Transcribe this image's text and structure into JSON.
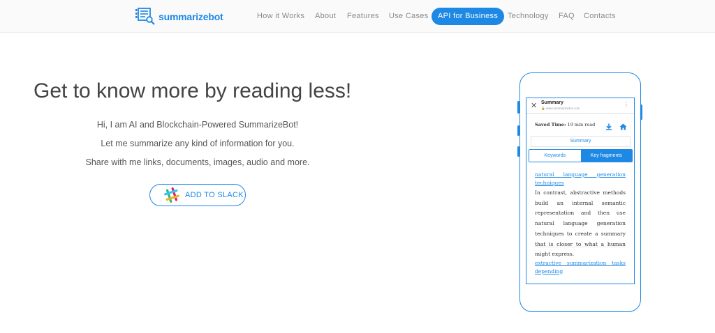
{
  "header": {
    "logo_text": "summarizebot",
    "logo_icon": "document-magnifier-icon",
    "nav": [
      {
        "label": "How it Works",
        "active": false
      },
      {
        "label": "About",
        "active": false
      },
      {
        "label": "Features",
        "active": false
      },
      {
        "label": "Use Cases",
        "active": false
      },
      {
        "label": "API for Business",
        "active": true
      },
      {
        "label": "Technology",
        "active": false
      },
      {
        "label": "FAQ",
        "active": false
      },
      {
        "label": "Contacts",
        "active": false
      }
    ]
  },
  "hero": {
    "headline": "Get to know more by reading less!",
    "lines": [
      "Hi, I am AI and Blockchain-Powered SummarizeBot!",
      "Let me summarize any kind of information for you.",
      "Share with me links, documents, images, audio and more."
    ],
    "slack_button": {
      "label": "ADD TO SLACK",
      "icon": "slack-icon"
    }
  },
  "phone": {
    "app_title": "Summary",
    "app_url": "🔒 www.summarizebot.com",
    "close_icon": "✕",
    "menu_icon": "⋮",
    "saved_time_label": "Saved Time:",
    "saved_time_value": "19 min read",
    "summary_tab": "Summary",
    "tabs": [
      {
        "label": "Keywords",
        "active": false
      },
      {
        "label": "Key fragments",
        "active": true
      }
    ],
    "fragment1_link_line1": "natural language generation",
    "fragment1_link_line2": "techniques",
    "fragment1_text": "In contrast, abstractive methods build an internal semantic representation and then use natural language generation techniques to create a summary that is closer to what a human might express.",
    "fragment2_link_line1": "extractive summarization tasks",
    "fragment2_link_line2": "depending"
  },
  "colors": {
    "accent": "#1e88e5",
    "text": "#444444",
    "muted": "#8a8a8a"
  }
}
